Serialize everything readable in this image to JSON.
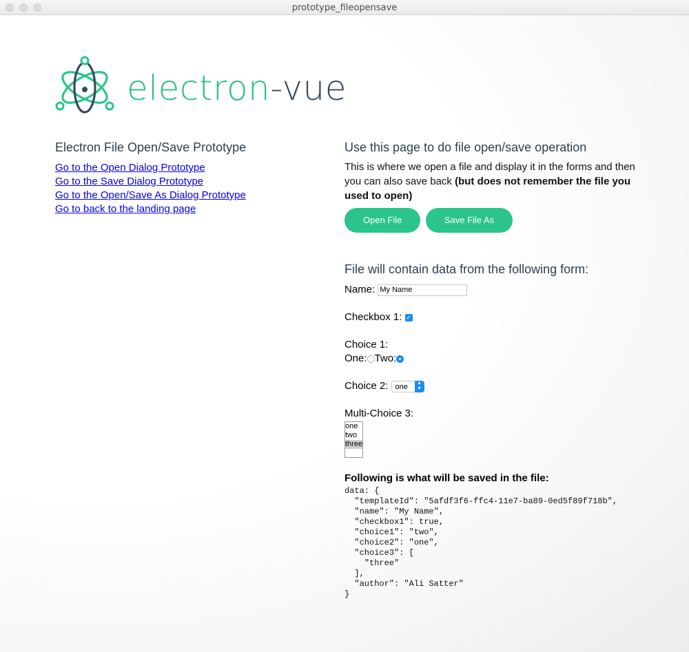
{
  "window": {
    "title": "prototype_fileopensave"
  },
  "logo": {
    "part1": "electron",
    "part2": "-vue"
  },
  "left": {
    "heading": "Electron File Open/Save Prototype",
    "links": [
      "Go to the Open Dialog Prototype",
      "Go to the Save Dialog Prototype",
      "Go to the Open/Save As Dialog Prototype",
      "Go to back to the landing page"
    ]
  },
  "right": {
    "heading": "Use this page to do file open/save operation",
    "desc_plain": "This is where we open a file and display it in the forms and then you can also save back ",
    "desc_bold": "(but does not remember the file you used to open)",
    "open_button": "Open File",
    "save_as_button": "Save File As",
    "form_heading": "File will contain data from the following form:"
  },
  "form": {
    "name_label": "Name:",
    "name_value": "My Name",
    "checkbox_label": "Checkbox 1:",
    "checkbox_checked": true,
    "choice1_label": "Choice 1:",
    "choice1_one": "One:",
    "choice1_two": "Two:",
    "choice1_selected": "two",
    "choice2_label": "Choice 2:",
    "choice2_value": "one",
    "choice3_label": "Multi-Choice 3:",
    "choice3_options": [
      "one",
      "two",
      "three"
    ],
    "choice3_selected": [
      "three"
    ]
  },
  "output": {
    "heading": "Following is what will be saved in the file:",
    "json_text": "data: {\n  \"templateId\": \"5afdf3f6-ffc4-11e7-ba89-0ed5f89f718b\",\n  \"name\": \"My Name\",\n  \"checkbox1\": true,\n  \"choice1\": \"two\",\n  \"choice2\": \"one\",\n  \"choice3\": [\n    \"three\"\n  ],\n  \"author\": \"Ali Satter\"\n}"
  },
  "colors": {
    "accent_green": "#2bc48b",
    "navy": "#35495e",
    "link": "#0000ee"
  }
}
